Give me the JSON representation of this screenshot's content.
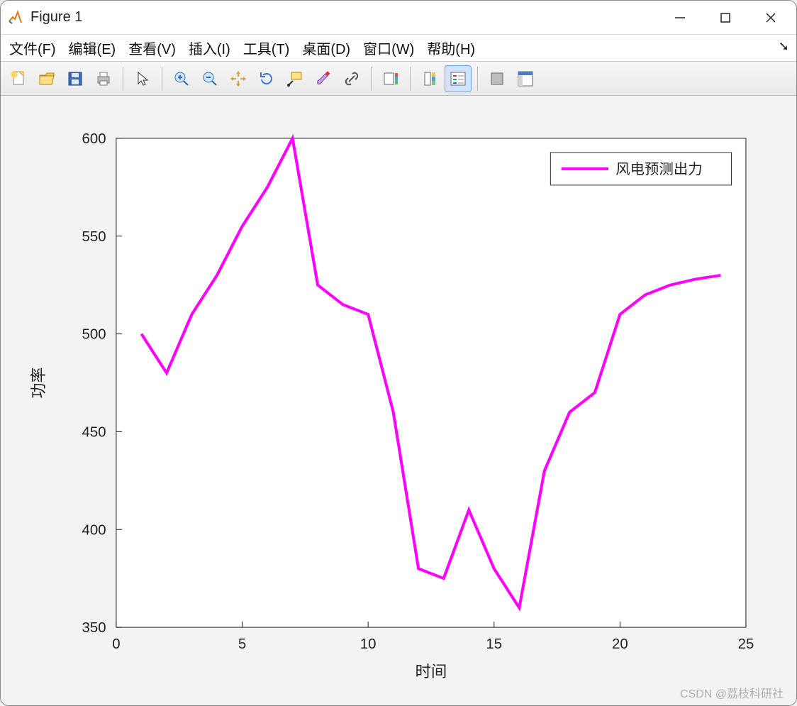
{
  "window": {
    "title": "Figure 1",
    "controls": {
      "min": "minimize",
      "max": "maximize",
      "close": "close"
    }
  },
  "menu": {
    "file": {
      "label": "文件(F)"
    },
    "edit": {
      "label": "编辑(E)"
    },
    "view": {
      "label": "查看(V)"
    },
    "insert": {
      "label": "插入(I)"
    },
    "tools": {
      "label": "工具(T)"
    },
    "desktop": {
      "label": "桌面(D)"
    },
    "window": {
      "label": "窗口(W)"
    },
    "help": {
      "label": "帮助(H)"
    }
  },
  "toolbar": {
    "new": "new-file-icon",
    "open": "open-folder-icon",
    "save": "save-icon",
    "print": "print-icon",
    "pointer": "pointer-icon",
    "zoom_in": "zoom-in-icon",
    "zoom_out": "zoom-out-icon",
    "pan": "pan-icon",
    "rotate": "rotate-icon",
    "data_cursor": "data-cursor-icon",
    "brush": "brush-icon",
    "link": "link-icon",
    "colorbar": "colorbar-icon",
    "legend": "legend-icon",
    "hide_plot_tools": "hide-plot-tools-icon",
    "show_plot_tools": "show-plot-tools-icon"
  },
  "chart_data": {
    "type": "line",
    "title": "",
    "xlabel": "时间",
    "ylabel": "功率",
    "xlim": [
      0,
      25
    ],
    "ylim": [
      350,
      600
    ],
    "xticks": [
      0,
      5,
      10,
      15,
      20,
      25
    ],
    "yticks": [
      350,
      400,
      450,
      500,
      550,
      600
    ],
    "series": [
      {
        "name": "风电预测出力",
        "color": "#ff00ff",
        "x": [
          1,
          2,
          3,
          4,
          5,
          6,
          7,
          8,
          9,
          10,
          11,
          12,
          13,
          14,
          15,
          16,
          17,
          18,
          19,
          20,
          21,
          22,
          23,
          24
        ],
        "y": [
          500,
          480,
          510,
          530,
          555,
          575,
          600,
          525,
          515,
          510,
          460,
          380,
          375,
          410,
          380,
          360,
          430,
          460,
          470,
          510,
          520,
          525,
          528,
          530
        ]
      }
    ],
    "legend": {
      "position": "upper-right",
      "entries": [
        "风电预测出力"
      ]
    }
  },
  "watermark": "CSDN @荔枝科研社"
}
